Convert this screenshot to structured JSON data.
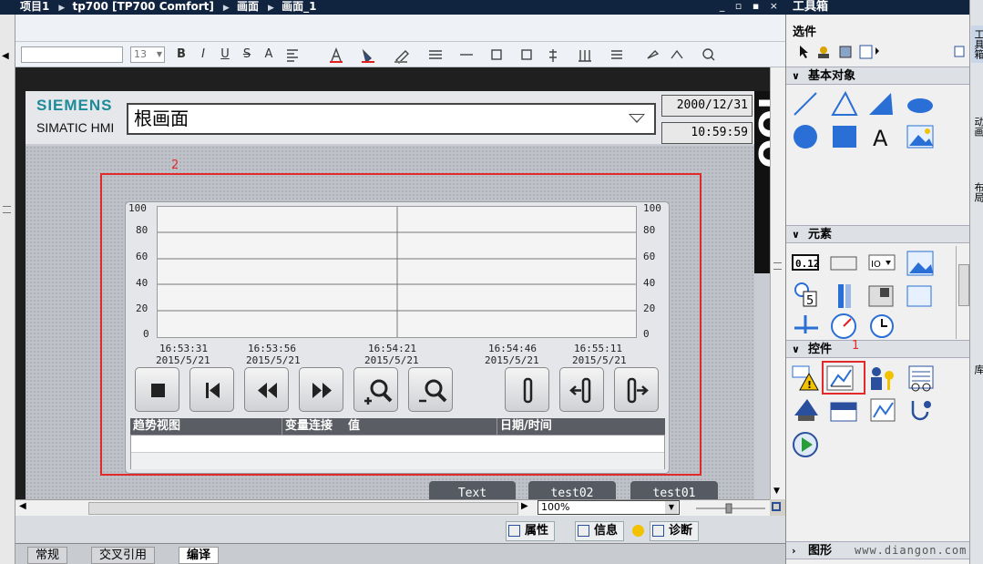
{
  "titlebar": {
    "crumbs": [
      "项目1",
      "tp700 [TP700 Comfort]",
      "画面",
      "画面_1"
    ],
    "window_buttons": "_ ▫ ▪ ×"
  },
  "toolbar": {
    "font_name": "",
    "font_size": "13",
    "bold": "B",
    "italic": "I",
    "underline": "U",
    "strike": "S",
    "font_size_btn": "A"
  },
  "hmi": {
    "brand": "SIEMENS",
    "product": "SIMATIC HMI",
    "screen_name": "根画面",
    "date": "2000/12/31",
    "time": "10:59:59",
    "side_text": "IOO"
  },
  "annotations": {
    "marker_2": "2",
    "marker_1": "1"
  },
  "trend": {
    "y_ticks": [
      "100",
      "80",
      "60",
      "40",
      "20",
      "0"
    ],
    "x_times": [
      "16:53:31",
      "16:53:56",
      "16:54:21",
      "16:54:46",
      "16:55:11"
    ],
    "x_dates": [
      "2015/5/21",
      "2015/5/21",
      "2015/5/21",
      "2015/5/21",
      "2015/5/21"
    ],
    "table_headers": [
      "趋势视图",
      "变量连接",
      "值",
      "日期/时间"
    ]
  },
  "hmi_buttons": [
    "Text",
    "test02",
    "test01"
  ],
  "zoom": "100%",
  "inspector_tabs": [
    "属性",
    "信息",
    "诊断"
  ],
  "bottom_tabs": [
    "常规",
    "交叉引用",
    "编译"
  ],
  "toolbox": {
    "title": "工具箱",
    "options": "选件",
    "sections": [
      "基本对象",
      "元素",
      "控件",
      "图形"
    ]
  },
  "right_edge_labels": [
    "工具箱",
    "动画",
    "布局",
    "库"
  ],
  "watermark": "www.diangon.com",
  "colors": {
    "siemens": "#1c8b99",
    "selection": "#e32a2a",
    "titlebar": "#10243f"
  }
}
